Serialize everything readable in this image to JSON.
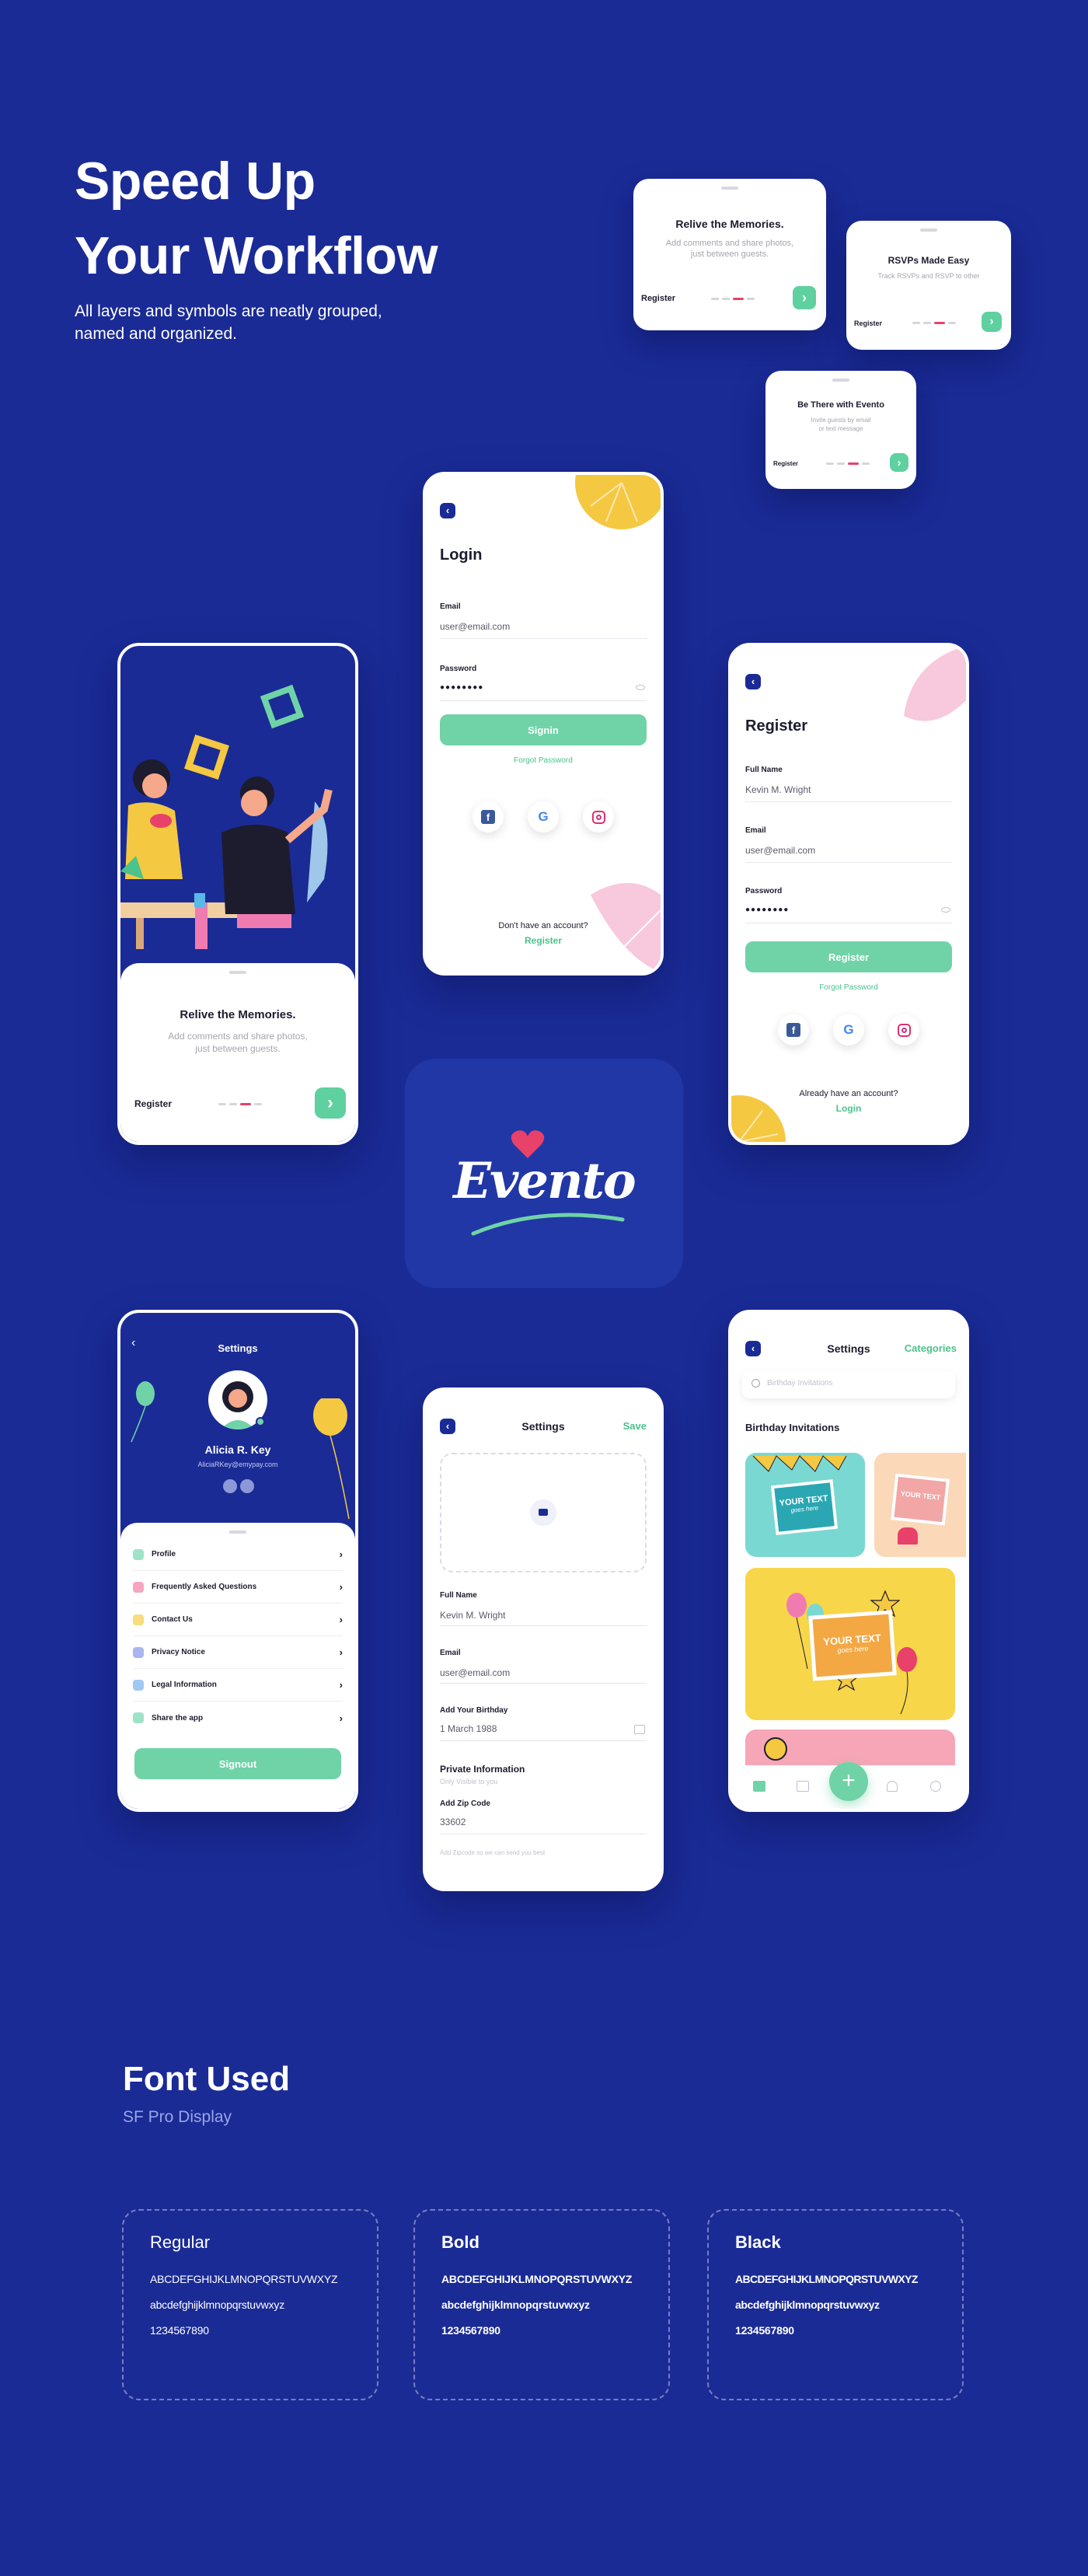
{
  "hero": {
    "title_line1": "Speed Up",
    "title_line2": "Your Workflow",
    "subtitle_line1": "All layers and symbols are neatly grouped,",
    "subtitle_line2": "named and organized."
  },
  "onboarding": [
    {
      "title": "Relive the Memories.",
      "sub_line1": "Add comments and share photos,",
      "sub_line2": "just between guests.",
      "register": "Register"
    },
    {
      "title": "RSVPs Made Easy",
      "sub_line1": "Track RSVPs and RSVP to other",
      "sub_line2": "",
      "register": "Register"
    },
    {
      "title": "Be There with Evento",
      "sub_line1": "Invite guests by email",
      "sub_line2": "or text message",
      "register": "Register"
    }
  ],
  "intro_phone": {
    "title": "Relive the Memories.",
    "sub_line1": "Add comments and share photos,",
    "sub_line2": "just between guests.",
    "register": "Register"
  },
  "login": {
    "title": "Login",
    "email_label": "Email",
    "email_value": "user@email.com",
    "password_label": "Password",
    "password_value": "●●●●●●●●",
    "signin": "Signin",
    "forgot": "Forgot Password",
    "no_account": "Don't have an account?",
    "register": "Register"
  },
  "register": {
    "title": "Register",
    "name_label": "Full Name",
    "name_value": "Kevin M. Wright",
    "email_label": "Email",
    "email_value": "user@email.com",
    "password_label": "Password",
    "password_value": "●●●●●●●●",
    "button": "Register",
    "forgot": "Forgot Password",
    "have_account": "Already have an account?",
    "login": "Login"
  },
  "logo": {
    "text": "Evento"
  },
  "settings_profile": {
    "title": "Settings",
    "name": "Alicia R. Key",
    "email": "AliciaRKey@emypay.com",
    "menu": [
      "Profile",
      "Frequently Asked Questions",
      "Contact Us",
      "Privacy Notice",
      "Legal Information",
      "Share the app"
    ],
    "signout": "Signout"
  },
  "settings_edit": {
    "title": "Settings",
    "save": "Save",
    "name_label": "Full Name",
    "name_value": "Kevin M. Wright",
    "email_label": "Email",
    "email_value": "user@email.com",
    "birthday_label": "Add Your Birthday",
    "birthday_value": "1 March 1988",
    "private_title": "Private Information",
    "private_sub": "Only Visible to you",
    "zip_label": "Add Zip Code",
    "zip_value": "33602",
    "footnote": "Add Zipcode so we can send you best"
  },
  "categories": {
    "title": "Settings",
    "categories_link": "Categories",
    "search_placeholder": "Birthday Invitations",
    "section": "Birthday Invitations",
    "card_text": "YOUR TEXT",
    "card_script": "goes here"
  },
  "fonts": {
    "heading": "Font Used",
    "family": "SF Pro Display",
    "upper": "ABCDEFGHIJKLMNOPQRSTUVWXYZ",
    "lower": "abcdefghijklmnopqrstuvwxyz",
    "digits": "1234567890",
    "weights": [
      "Regular",
      "Bold",
      "Black"
    ]
  },
  "colors": {
    "background": "#1a2b96",
    "accent_green": "#6fd3a7",
    "brand_pink": "#e8416a",
    "brand_yellow": "#f5c842"
  }
}
